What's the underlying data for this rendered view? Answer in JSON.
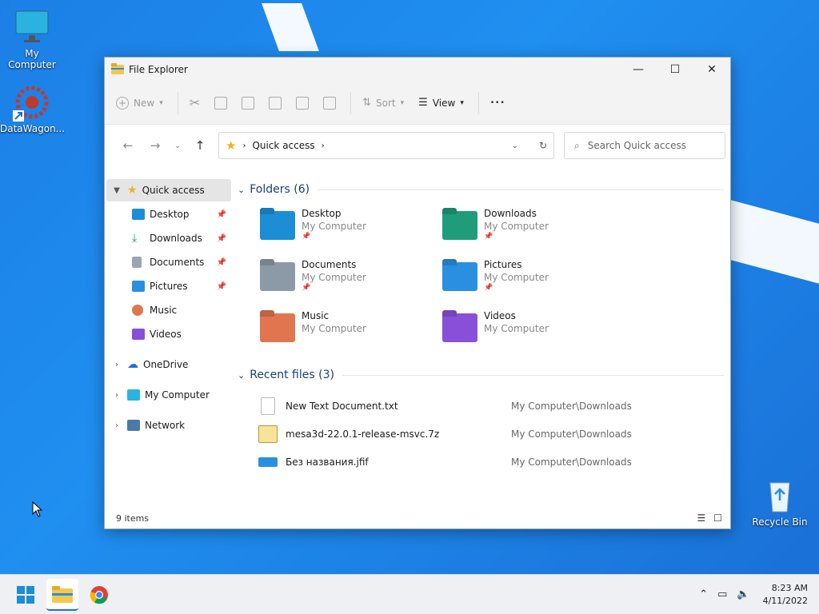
{
  "desktop": {
    "icons": [
      {
        "label": "My Computer"
      },
      {
        "label": "DataWagon..."
      },
      {
        "label": "Recycle Bin"
      }
    ]
  },
  "window": {
    "title": "File Explorer",
    "controls": {
      "minimize": "—",
      "maximize": "☐",
      "close": "✕"
    }
  },
  "cmdbar": {
    "new": "New",
    "sort": "Sort",
    "view": "View",
    "more": "•••"
  },
  "address": {
    "location": "Quick access",
    "search_placeholder": "Search Quick access"
  },
  "sidebar": {
    "items": [
      {
        "label": "Quick access"
      },
      {
        "label": "Desktop"
      },
      {
        "label": "Downloads"
      },
      {
        "label": "Documents"
      },
      {
        "label": "Pictures"
      },
      {
        "label": "Music"
      },
      {
        "label": "Videos"
      },
      {
        "label": "OneDrive"
      },
      {
        "label": "My Computer"
      },
      {
        "label": "Network"
      }
    ]
  },
  "folders": {
    "header": "Folders (6)",
    "items": [
      {
        "name": "Desktop",
        "location": "My Computer",
        "color": "#1b8ed6"
      },
      {
        "name": "Downloads",
        "location": "My Computer",
        "color": "#1f9d7a"
      },
      {
        "name": "Documents",
        "location": "My Computer",
        "color": "#8c9aa8"
      },
      {
        "name": "Pictures",
        "location": "My Computer",
        "color": "#2a8fe0"
      },
      {
        "name": "Music",
        "location": "My Computer",
        "color": "#e0754f"
      },
      {
        "name": "Videos",
        "location": "My Computer",
        "color": "#8a4fd8"
      }
    ]
  },
  "recent": {
    "header": "Recent files (3)",
    "items": [
      {
        "name": "New Text Document.txt",
        "location": "My Computer\\Downloads"
      },
      {
        "name": "mesa3d-22.0.1-release-msvc.7z",
        "location": "My Computer\\Downloads"
      },
      {
        "name": "Без названия.jfif",
        "location": "My Computer\\Downloads"
      }
    ]
  },
  "status": {
    "count": "9 items"
  },
  "taskbar": {
    "time": "8:23 AM",
    "date": "4/11/2022"
  }
}
